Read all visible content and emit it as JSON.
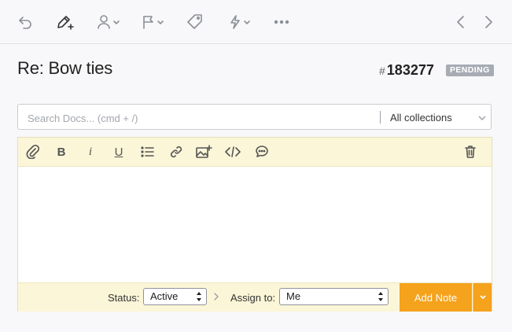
{
  "toolbar": {
    "icons": [
      "undo-icon",
      "edit-add-icon",
      "user-assign-icon",
      "flag-icon",
      "tag-icon",
      "bolt-icon",
      "more-icon",
      "prev-icon",
      "next-icon"
    ]
  },
  "ticket": {
    "title": "Re: Bow ties",
    "hash": "#",
    "number": "183277",
    "status_badge": "PENDING"
  },
  "search": {
    "placeholder": "Search Docs... (cmd + /)",
    "collections": "All collections"
  },
  "editor": {
    "format_bold": "B",
    "format_italic": "i",
    "format_underline": "U"
  },
  "footer": {
    "status_label": "Status:",
    "status_value": "Active",
    "assign_label": "Assign to:",
    "assign_value": "Me",
    "add_note": "Add Note"
  },
  "colors": {
    "accent": "#f5a21d",
    "editor_bar": "#fcf6d8",
    "badge": "#a6abb4"
  }
}
